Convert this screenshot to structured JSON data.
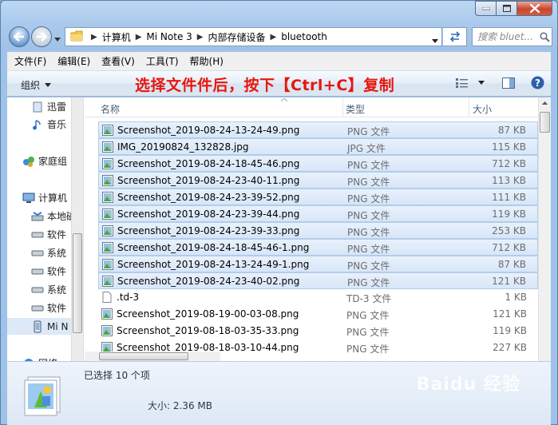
{
  "address": {
    "crumbs": [
      "计算机",
      "Mi Note 3",
      "内部存储设备",
      "bluetooth"
    ]
  },
  "search": {
    "placeholder": "搜索 bluet..."
  },
  "menu": [
    "文件(F)",
    "编辑(E)",
    "查看(V)",
    "工具(T)",
    "帮助(H)"
  ],
  "toolbar": {
    "organize_label": "组织",
    "banner_text": "选择文件件后，按下【Ctrl+C】复制"
  },
  "nav": {
    "items": [
      {
        "label": "迅雷",
        "icon": "thunder-icon"
      },
      {
        "label": "音乐",
        "icon": "music-icon"
      },
      {
        "label": "家庭组",
        "icon": "homegroup-icon"
      },
      {
        "label": "计算机",
        "icon": "computer-icon"
      },
      {
        "label": "本地磁",
        "icon": "local-disk-icon"
      },
      {
        "label": "软件",
        "icon": "drive-icon"
      },
      {
        "label": "系统",
        "icon": "drive-icon"
      },
      {
        "label": "软件",
        "icon": "drive-icon"
      },
      {
        "label": "系统",
        "icon": "drive-icon"
      },
      {
        "label": "软件",
        "icon": "drive-icon"
      },
      {
        "label": "Mi N",
        "icon": "phone-icon"
      },
      {
        "label": "网络",
        "icon": "network-icon"
      }
    ]
  },
  "columns": {
    "name": "名称",
    "type": "类型",
    "size": "大小"
  },
  "files": [
    {
      "name": "Screenshot_2019-08-24-13-24-49.png",
      "type": "PNG 文件",
      "size": "87 KB",
      "selected": true,
      "icon": "image-icon"
    },
    {
      "name": "IMG_20190824_132828.jpg",
      "type": "JPG 文件",
      "size": "115 KB",
      "selected": true,
      "icon": "image-icon"
    },
    {
      "name": "Screenshot_2019-08-24-18-45-46.png",
      "type": "PNG 文件",
      "size": "712 KB",
      "selected": true,
      "icon": "image-icon"
    },
    {
      "name": "Screenshot_2019-08-24-23-40-11.png",
      "type": "PNG 文件",
      "size": "113 KB",
      "selected": true,
      "icon": "image-icon"
    },
    {
      "name": "Screenshot_2019-08-24-23-39-52.png",
      "type": "PNG 文件",
      "size": "111 KB",
      "selected": true,
      "icon": "image-icon"
    },
    {
      "name": "Screenshot_2019-08-24-23-39-44.png",
      "type": "PNG 文件",
      "size": "119 KB",
      "selected": true,
      "icon": "image-icon"
    },
    {
      "name": "Screenshot_2019-08-24-23-39-33.png",
      "type": "PNG 文件",
      "size": "253 KB",
      "selected": true,
      "icon": "image-icon"
    },
    {
      "name": "Screenshot_2019-08-24-18-45-46-1.png",
      "type": "PNG 文件",
      "size": "712 KB",
      "selected": true,
      "icon": "image-icon"
    },
    {
      "name": "Screenshot_2019-08-24-13-24-49-1.png",
      "type": "PNG 文件",
      "size": "87 KB",
      "selected": true,
      "icon": "image-icon"
    },
    {
      "name": "Screenshot_2019-08-24-23-40-02.png",
      "type": "PNG 文件",
      "size": "121 KB",
      "selected": true,
      "icon": "image-icon"
    },
    {
      "name": ".td-3",
      "type": "TD-3 文件",
      "size": "1 KB",
      "selected": false,
      "icon": "file-icon"
    },
    {
      "name": "Screenshot_2019-08-19-00-03-08.png",
      "type": "PNG 文件",
      "size": "121 KB",
      "selected": false,
      "icon": "image-icon"
    },
    {
      "name": "Screenshot_2019-08-18-03-35-33.png",
      "type": "PNG 文件",
      "size": "119 KB",
      "selected": false,
      "icon": "image-icon"
    },
    {
      "name": "Screenshot_2019-08-18-03-10-44.png",
      "type": "PNG 文件",
      "size": "227 KB",
      "selected": false,
      "icon": "image-icon"
    }
  ],
  "details": {
    "selection_text": "已选择 10 个项",
    "size_text": "大小: 2.36 MB"
  },
  "watermark": "Baidu 经验",
  "colors": {
    "banner": "#e8160c",
    "selection": "#d7e6f8"
  }
}
